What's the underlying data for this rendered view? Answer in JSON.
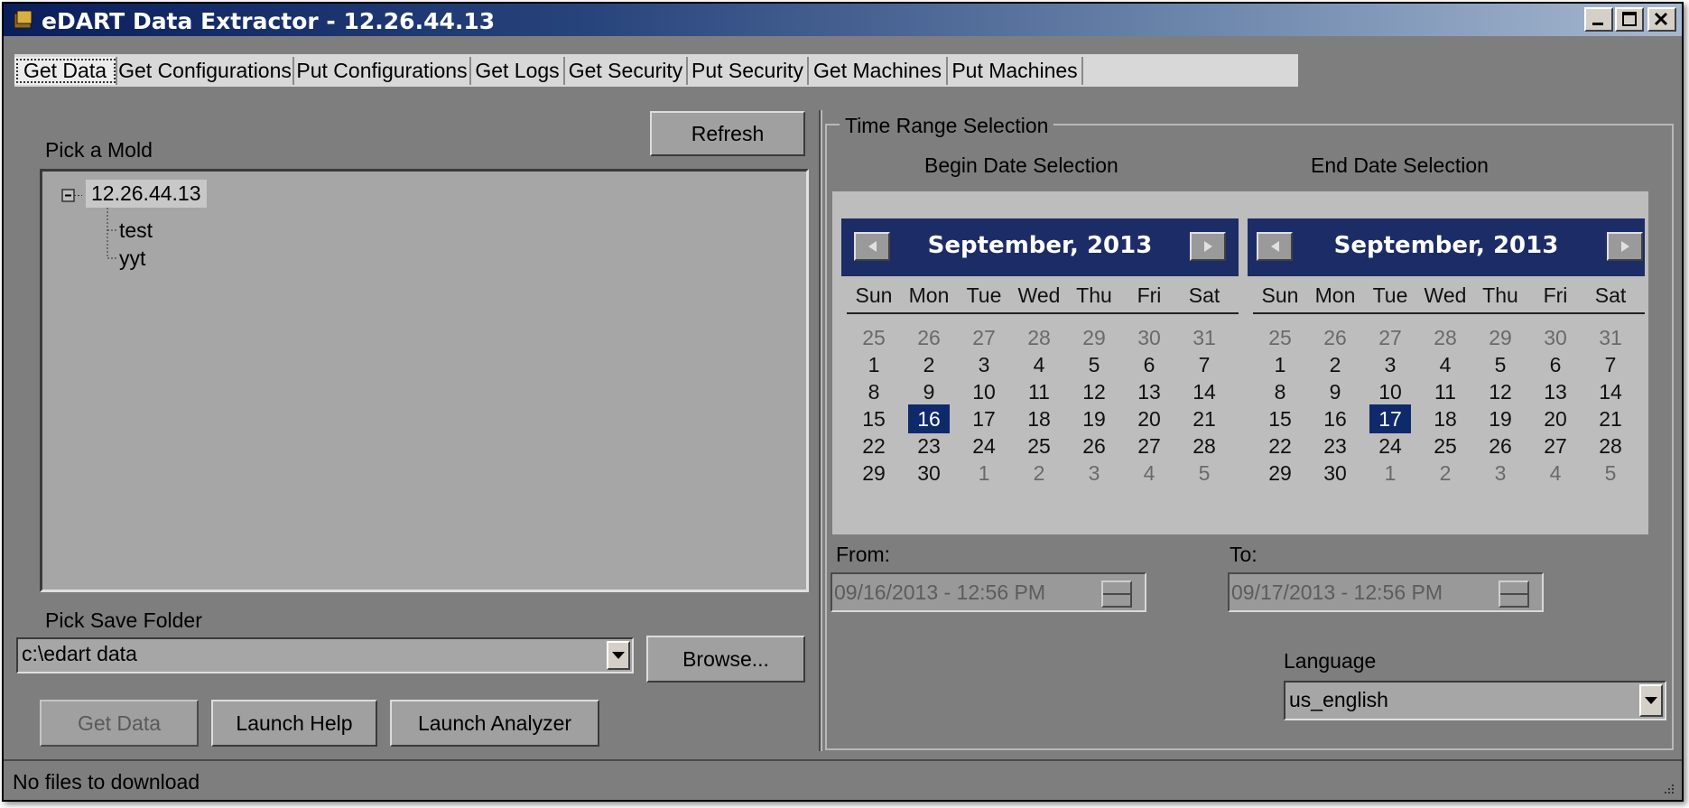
{
  "window": {
    "title": "eDART Data Extractor  -  12.26.44.13"
  },
  "tabs": [
    "Get Data",
    "Get Configurations",
    "Put Configurations",
    "Get Logs",
    "Get Security",
    "Put Security",
    "Get Machines",
    "Put Machines"
  ],
  "left": {
    "pick_mold_label": "Pick a Mold",
    "refresh_label": "Refresh",
    "tree": {
      "root": "12.26.44.13",
      "children": [
        "test",
        "yyt"
      ]
    },
    "save_folder_label": "Pick Save Folder",
    "save_folder_value": "c:\\edart data",
    "browse_label": "Browse...",
    "get_data_label": "Get Data",
    "launch_help_label": "Launch Help",
    "launch_analyzer_label": "Launch Analyzer"
  },
  "right": {
    "group_title": "Time Range Selection",
    "begin_label": "Begin Date Selection",
    "end_label": "End Date Selection",
    "weekdays": [
      "Sun",
      "Mon",
      "Tue",
      "Wed",
      "Thu",
      "Fri",
      "Sat"
    ],
    "begin_calendar": {
      "month": "September, 2013",
      "selected": 16
    },
    "end_calendar": {
      "month": "September, 2013",
      "selected": 17
    },
    "days": [
      [
        25,
        26,
        27,
        28,
        29,
        30,
        31
      ],
      [
        1,
        2,
        3,
        4,
        5,
        6,
        7
      ],
      [
        8,
        9,
        10,
        11,
        12,
        13,
        14
      ],
      [
        15,
        16,
        17,
        18,
        19,
        20,
        21
      ],
      [
        22,
        23,
        24,
        25,
        26,
        27,
        28
      ],
      [
        29,
        30,
        1,
        2,
        3,
        4,
        5
      ]
    ],
    "from_label": "From:",
    "from_value": "09/16/2013 - 12:56 PM",
    "to_label": "To:",
    "to_value": "09/17/2013 - 12:56 PM",
    "language_label": "Language",
    "language_value": "us_english"
  },
  "status": {
    "text": "No files to download"
  },
  "colors": {
    "calendar_header": "#1c2c66",
    "selected_day": "#0f2a6a",
    "window_bg": "#7e7e7e"
  }
}
